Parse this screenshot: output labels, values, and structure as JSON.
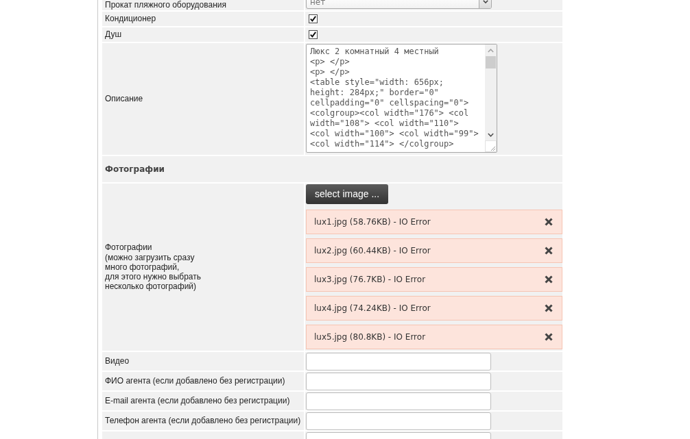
{
  "form": {
    "rows": [
      {
        "kind": "select",
        "label": "Прокат пляжного оборудования",
        "value": "нет"
      },
      {
        "kind": "checkbox",
        "label": "Кондиционер",
        "checked": true
      },
      {
        "kind": "checkbox",
        "label": "Душ",
        "checked": true
      },
      {
        "kind": "textarea",
        "label": "Описание",
        "value": "Люкс 2 комнатный 4 местный\n<p> </p>\n<p> </p>\n<table style=\"width: 656px; height: 284px;\" border=\"0\" cellpadding=\"0\" cellspacing=\"0\">\n<colgroup><col width=\"176\"> <col width=\"108\"> <col width=\"110\"> <col width=\"100\"> <col width=\"99\"> <col width=\"114\"> </colgroup>"
      },
      {
        "kind": "section",
        "title": "Фотографии"
      },
      {
        "kind": "upload",
        "label": "Фотографии\n(можно загрузить сразу\nмного фотографий,\nдля этого нужно выбрать\nнесколько фотографий)",
        "button": "select image ...",
        "files": [
          {
            "text": "lux1.jpg (58.76KB) - IO Error",
            "error": true
          },
          {
            "text": "lux2.jpg (60.44KB) - IO Error",
            "error": true
          },
          {
            "text": "lux3.jpg (76.7KB) - IO Error",
            "error": true
          },
          {
            "text": "lux4.jpg (74.24KB) - IO Error",
            "error": true
          },
          {
            "text": "lux5.jpg (80.8KB) - IO Error",
            "error": true
          }
        ]
      },
      {
        "kind": "input",
        "label": "Видео"
      },
      {
        "kind": "input",
        "label": "ФИО агента (если добавлено без регистрации)"
      },
      {
        "kind": "input",
        "label": "E-mail агента (если добавлено без регистрации)"
      },
      {
        "kind": "input",
        "label": "Телефон агента (если добавлено без регистрации)"
      },
      {
        "kind": "input"
      }
    ]
  }
}
